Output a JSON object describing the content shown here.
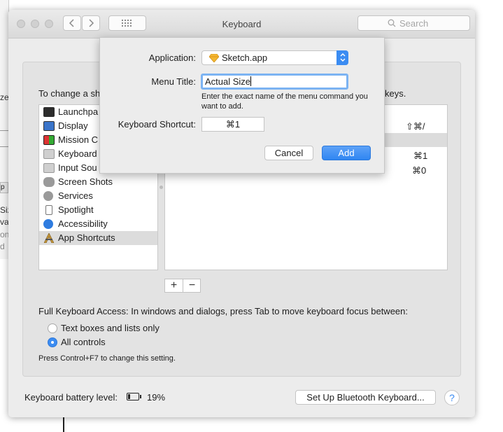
{
  "background_window": {
    "fragments": [
      "ze",
      "p",
      "Siz",
      "vas",
      "on",
      "d"
    ]
  },
  "window": {
    "title": "Keyboard",
    "search_placeholder": "Search",
    "back_glyph": "<",
    "forward_glyph": ">"
  },
  "pane": {
    "intro_left": "To change a sh",
    "intro_right": "keys.",
    "categories": [
      {
        "label": "Launchpa",
        "icon": "launchpad-icon",
        "color": "#2c2c2c"
      },
      {
        "label": "Display",
        "icon": "display-icon",
        "color": "#3a74c9"
      },
      {
        "label": "Mission C",
        "icon": "mission-control-icon",
        "color": "#2d2d2d"
      },
      {
        "label": "Keyboard",
        "icon": "keyboard-icon",
        "color": "#c8c8c8"
      },
      {
        "label": "Input Sou",
        "icon": "input-sources-icon",
        "color": "#c8c8c8"
      },
      {
        "label": "Screen Shots",
        "icon": "screen-shots-icon",
        "color": "#8a8a8a"
      },
      {
        "label": "Services",
        "icon": "services-icon",
        "color": "#9a9a9a"
      },
      {
        "label": "Spotlight",
        "icon": "spotlight-icon",
        "color": "#cfcfcf"
      },
      {
        "label": "Accessibility",
        "icon": "accessibility-icon",
        "color": "#2e7ce0"
      },
      {
        "label": "App Shortcuts",
        "icon": "app-shortcuts-icon",
        "color": "#c99a3a"
      }
    ],
    "selected_category": "App Shortcuts",
    "shortcuts": [
      {
        "key": "⇧⌘/"
      },
      {
        "key": ""
      },
      {
        "key": "⌘1"
      },
      {
        "key": "⌘0"
      }
    ],
    "add_glyph": "+",
    "remove_glyph": "−"
  },
  "full_keyboard_access": {
    "label": "Full Keyboard Access: In windows and dialogs, press Tab to move keyboard focus between:",
    "options": [
      {
        "label": "Text boxes and lists only",
        "selected": false
      },
      {
        "label": "All controls",
        "selected": true
      }
    ],
    "note": "Press Control+F7 to change this setting."
  },
  "footer": {
    "battery_label": "Keyboard battery level:",
    "battery_percent": "19%",
    "battery_level": 0.19,
    "setup_button": "Set Up Bluetooth Keyboard...",
    "help_glyph": "?"
  },
  "sheet": {
    "application_label": "Application:",
    "application_value": "Sketch.app",
    "menu_title_label": "Menu Title:",
    "menu_title_value": "Actual Size",
    "hint": "Enter the exact name of the menu command you want to add.",
    "shortcut_label": "Keyboard Shortcut:",
    "shortcut_value": "⌘1",
    "cancel_label": "Cancel",
    "add_label": "Add"
  },
  "colors": {
    "accent": "#3b8cf2",
    "sketch_icon": "#f2b632"
  }
}
